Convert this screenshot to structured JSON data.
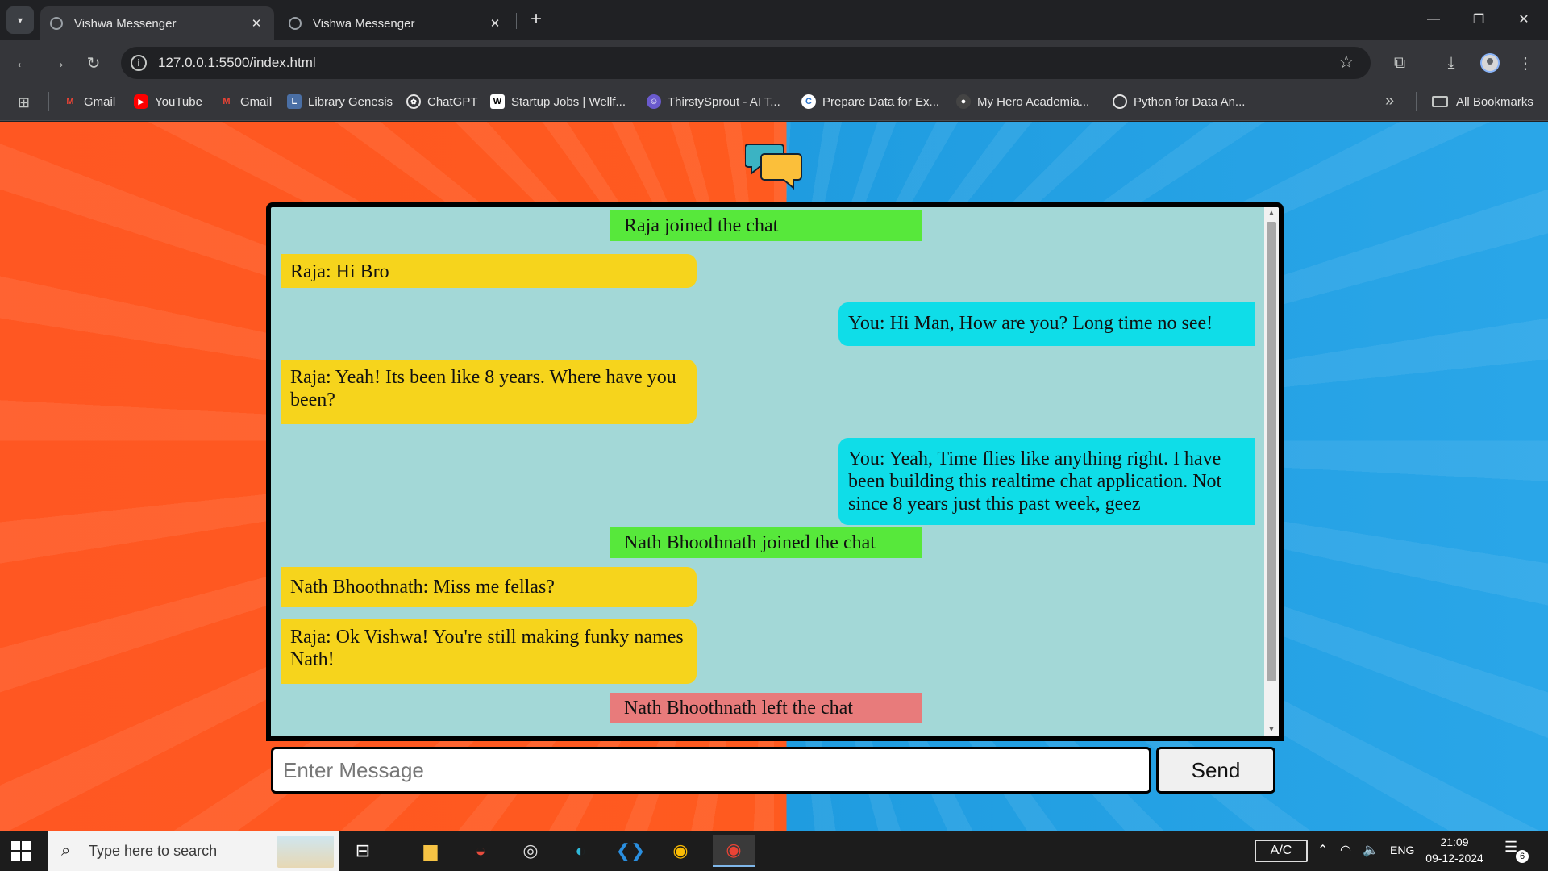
{
  "browser": {
    "tabs": [
      {
        "title": "Vishwa Messenger",
        "active": true
      },
      {
        "title": "Vishwa Messenger",
        "active": false
      }
    ],
    "url": "127.0.0.1:5500/index.html",
    "bookmarks": [
      {
        "label": "Gmail",
        "icon": "gmail-icon",
        "color": "#ea4335"
      },
      {
        "label": "YouTube",
        "icon": "youtube-icon",
        "color": "#ff0000"
      },
      {
        "label": "Gmail",
        "icon": "gmail-icon",
        "color": "#ea4335"
      },
      {
        "label": "Library Genesis",
        "icon": "library-genesis-icon",
        "color": "#4a6fa5"
      },
      {
        "label": "ChatGPT",
        "icon": "chatgpt-icon",
        "color": "#5f6368"
      },
      {
        "label": "Startup Jobs | Wellf...",
        "icon": "wellfound-icon",
        "color": "#ffffff"
      },
      {
        "label": "ThirstySprout - AI T...",
        "icon": "thirstysprout-icon",
        "color": "#6a5acd"
      },
      {
        "label": "Prepare Data for Ex...",
        "icon": "coursera-icon",
        "color": "#2a73cc"
      },
      {
        "label": "My Hero Academia...",
        "icon": "anime-icon",
        "color": "#444444"
      },
      {
        "label": "Python for Data An...",
        "icon": "globe-icon",
        "color": "#5f6368"
      }
    ],
    "all_bookmarks": "All Bookmarks"
  },
  "chat": {
    "messages": [
      {
        "type": "join",
        "text": "Raja joined the chat"
      },
      {
        "type": "incoming",
        "text": "Raja: Hi Bro"
      },
      {
        "type": "outgoing",
        "text": "You: Hi Man, How are you? Long time no see!"
      },
      {
        "type": "incoming",
        "text": "Raja: Yeah! Its been like 8 years. Where have you been?"
      },
      {
        "type": "outgoing",
        "text": "You: Yeah, Time flies like anything right. I have been building this realtime chat application. Not since 8 years just this past week, geez"
      },
      {
        "type": "join",
        "text": "Nath Bhoothnath joined the chat"
      },
      {
        "type": "incoming",
        "text": "Nath Bhoothnath: Miss me fellas?"
      },
      {
        "type": "incoming",
        "text": "Raja: Ok Vishwa! You're still making funky names Nath!"
      },
      {
        "type": "leave",
        "text": "Nath Bhoothnath left the chat"
      }
    ],
    "input_placeholder": "Enter Message",
    "send_label": "Send",
    "colors": {
      "join": "#57e83b",
      "leave": "#e87b7b",
      "incoming": "#f6d41c",
      "outgoing": "#0fdde8",
      "background": "#a3d8d7"
    }
  },
  "taskbar": {
    "search_placeholder": "Type here to search",
    "apps": [
      "task-view-icon",
      "file-explorer-icon",
      "app-icon",
      "obs-icon",
      "edge-icon",
      "vscode-icon",
      "chrome-icon",
      "chrome-profile-icon"
    ],
    "ac_label": "A/C",
    "language": "ENG",
    "time": "21:09",
    "date": "09-12-2024",
    "notification_count": "6"
  }
}
